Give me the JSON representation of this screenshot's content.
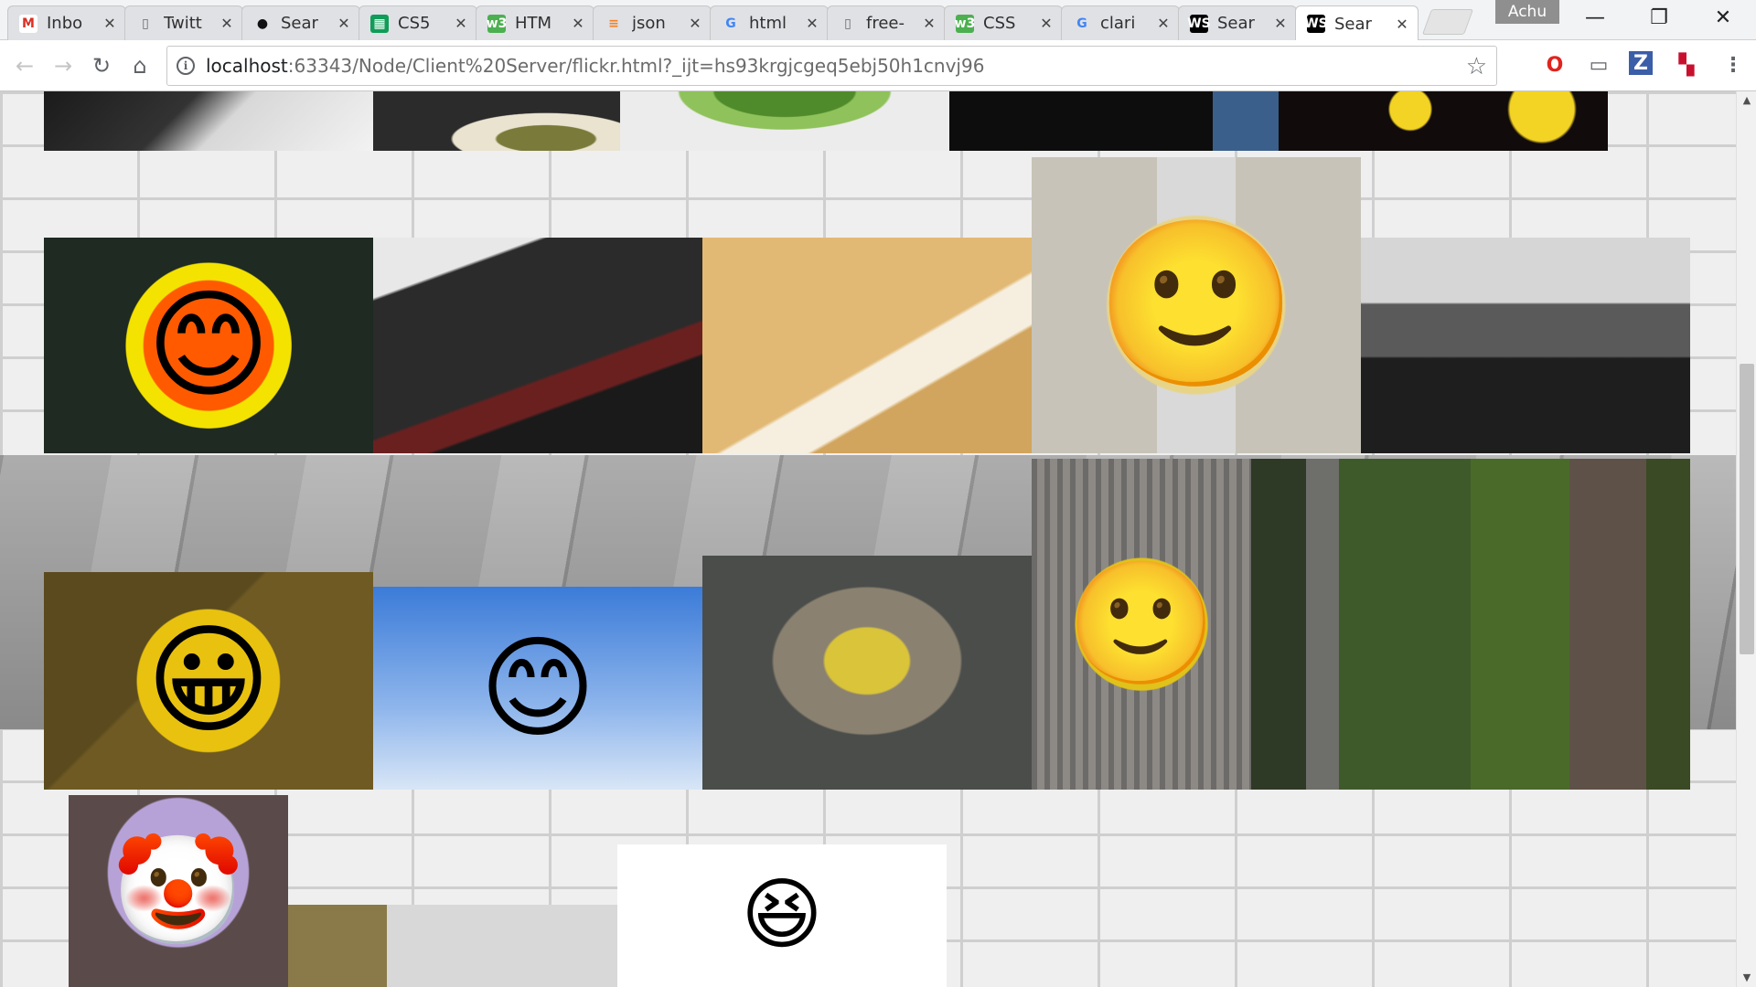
{
  "browser": {
    "tabs": [
      {
        "title": "Inbo",
        "icon": "gmail-icon",
        "glyph": "M",
        "color": "#d93025",
        "bg": "#ffffff"
      },
      {
        "title": "Twitt",
        "icon": "document-icon",
        "glyph": "▯",
        "color": "#666666",
        "bg": "transparent"
      },
      {
        "title": "Sear",
        "icon": "github-icon",
        "glyph": "●",
        "color": "#111111",
        "bg": "transparent"
      },
      {
        "title": "CS5",
        "icon": "sheets-icon",
        "glyph": "▦",
        "color": "#ffffff",
        "bg": "#0f9d58"
      },
      {
        "title": "HTM",
        "icon": "w3schools-icon",
        "glyph": "w3",
        "color": "#ffffff",
        "bg": "#4caf50"
      },
      {
        "title": "json",
        "icon": "stackoverflow-icon",
        "glyph": "≡",
        "color": "#f48024",
        "bg": "transparent"
      },
      {
        "title": "html",
        "icon": "google-icon",
        "glyph": "G",
        "color": "#4285f4",
        "bg": "transparent"
      },
      {
        "title": "free-",
        "icon": "document-icon",
        "glyph": "▯",
        "color": "#666666",
        "bg": "transparent"
      },
      {
        "title": "CSS",
        "icon": "w3schools-icon",
        "glyph": "w3",
        "color": "#ffffff",
        "bg": "#4caf50"
      },
      {
        "title": "clari",
        "icon": "google-icon",
        "glyph": "G",
        "color": "#4285f4",
        "bg": "transparent"
      },
      {
        "title": "Sear",
        "icon": "webstorm-icon",
        "glyph": "WS",
        "color": "#ffffff",
        "bg": "#000000"
      },
      {
        "title": "Sear",
        "icon": "webstorm-icon",
        "glyph": "WS",
        "color": "#ffffff",
        "bg": "#000000",
        "active": true
      }
    ],
    "profile_name": "Achu",
    "window_buttons": {
      "minimize": "—",
      "restore": "❐",
      "close": "✕"
    },
    "nav": {
      "back": "←",
      "forward": "→",
      "reload": "↻",
      "home": "⌂"
    },
    "url_host": "localhost",
    "url_path": ":63343/Node/Client%20Server/flickr.html?_ijt=hs93krgjcgeq5ebj50h1cnvj96",
    "bookmark_star": "☆",
    "extensions": [
      {
        "name": "opera-icon",
        "glyph": "O",
        "color": "#e0241e"
      },
      {
        "name": "cast-icon",
        "glyph": "▭",
        "color": "#5f6368"
      },
      {
        "name": "zotero-icon",
        "glyph": "Z",
        "color": "#ffffff",
        "bg": "#3b5ea8"
      },
      {
        "name": "flag-extension-icon",
        "glyph": "▚",
        "color": "#c8102e"
      },
      {
        "name": "menu-icon",
        "glyph": "⋮",
        "color": "#5f6368"
      }
    ]
  },
  "scrollbar": {
    "up": "▲",
    "down": "▼"
  },
  "gallery": {
    "photos": [
      {
        "name": "photo-police-officer",
        "bg": "linear-gradient(135deg,#1b1b1b 0%,#333 40%,#d8d8d8 55%,#f2f2f2 100%)"
      },
      {
        "name": "photo-dinner-plate",
        "bg": "radial-gradient(ellipse at 70% 80%,#7a7a3a 0 20%,#e9e3cf 21% 38%,#2b2b2b 39% 100%)"
      },
      {
        "name": "photo-green-apple",
        "bg": "radial-gradient(ellipse at 50% 0%,#4f8b2a 0 30%,#8fc25a 31% 45%,#ececec 46% 100%)"
      },
      {
        "name": "photo-man-plaid",
        "bg": "linear-gradient(90deg,#0d0d0d 0 40%,#3a5f8a 40% 55%,#0d0d0d 55% 100%)"
      },
      {
        "name": "photo-inspire-stars",
        "bg": "radial-gradient(circle at 80% 30%,#f3d324 0 12%,transparent 13%),radial-gradient(circle at 40% 30%,#f3d324 0 10%,transparent 11%),#120b0b"
      },
      {
        "name": "photo-crochet-sun",
        "bg": "#1e2a22",
        "emoji": "😊",
        "emoji_bg": "radial-gradient(circle,#ff5a00 0 55%,#f4e300 56% 70%,transparent 71%)"
      },
      {
        "name": "photo-dinner-friends",
        "bg": "linear-gradient(160deg,#e8e8e8 0 18%,#2b2b2b 19% 60%,#6b2020 61% 70%,#1a1a1a 71% 100%)"
      },
      {
        "name": "photo-sand-smile",
        "bg": "linear-gradient(150deg,#e2b974 0 55%,#f6efe0 56% 68%,#d2a55e 69% 100%)"
      },
      {
        "name": "photo-door-graffiti",
        "bg": "linear-gradient(90deg,#c7c3b8 0 38%,#d9d9d9 38% 62%,#c7c3b8 62% 100%)",
        "emoji": "🙂",
        "emoji_bg": "radial-gradient(ellipse,#e8d487 0 55%,transparent 56%)"
      },
      {
        "name": "photo-boy-laughing",
        "bg": "linear-gradient(180deg,#d6d6d6 0 30%,#5a5a5a 31% 55%,#1e1e1e 56% 100%)"
      },
      {
        "name": "photo-smiley-bell",
        "bg": "linear-gradient(135deg,#5a4a1e 0 40%,#6e5a22 41% 100%)",
        "emoji": "😀",
        "emoji_bg": "radial-gradient(circle,#e9c20f 0 60%,transparent 61%)"
      },
      {
        "name": "photo-smiley-balloon",
        "bg": "linear-gradient(180deg,#3b7bd8 0%,#8fb6ec 60%,#d8e6f6 100%)",
        "emoji": "😊",
        "emoji_bg": "none"
      },
      {
        "name": "photo-rock-smiley",
        "bg": "radial-gradient(ellipse at 50% 45%,#d9c43a 0 18%,#8b8170 19% 40%,#4a4d4a 41% 100%)"
      },
      {
        "name": "photo-tree-smiley",
        "bg": "repeating-linear-gradient(90deg,#6d6b69 0 6px,#8d8985 6px 14px)",
        "emoji": "🙂",
        "emoji_bg": "radial-gradient(circle,#e0c21a 0 55%,transparent 56%)"
      },
      {
        "name": "photo-bike-forest-1",
        "bg": "linear-gradient(90deg,#2f3a26 0 25%,#6e6e6a 25% 40%,#3f5a2a 40% 100%)"
      },
      {
        "name": "photo-bike-forest-2",
        "bg": "linear-gradient(90deg,#4a6a2a 0 45%,#5e5148 45% 80%,#3a4a24 80% 100%)"
      },
      {
        "name": "photo-clown-balloon",
        "bg": "radial-gradient(ellipse at 50% 40%,#b7a2d8 0 45%,#5a4a4a 46% 100%)",
        "emoji": "🤡",
        "emoji_bg": "none"
      },
      {
        "name": "photo-toy-figure",
        "bg": "linear-gradient(90deg,#8a7a4a 0 30%,#d8d8d8 30% 100%)"
      },
      {
        "name": "photo-laughing-emoji",
        "bg": "#ffffff",
        "emoji": "😆",
        "emoji_bg": "none"
      }
    ]
  }
}
